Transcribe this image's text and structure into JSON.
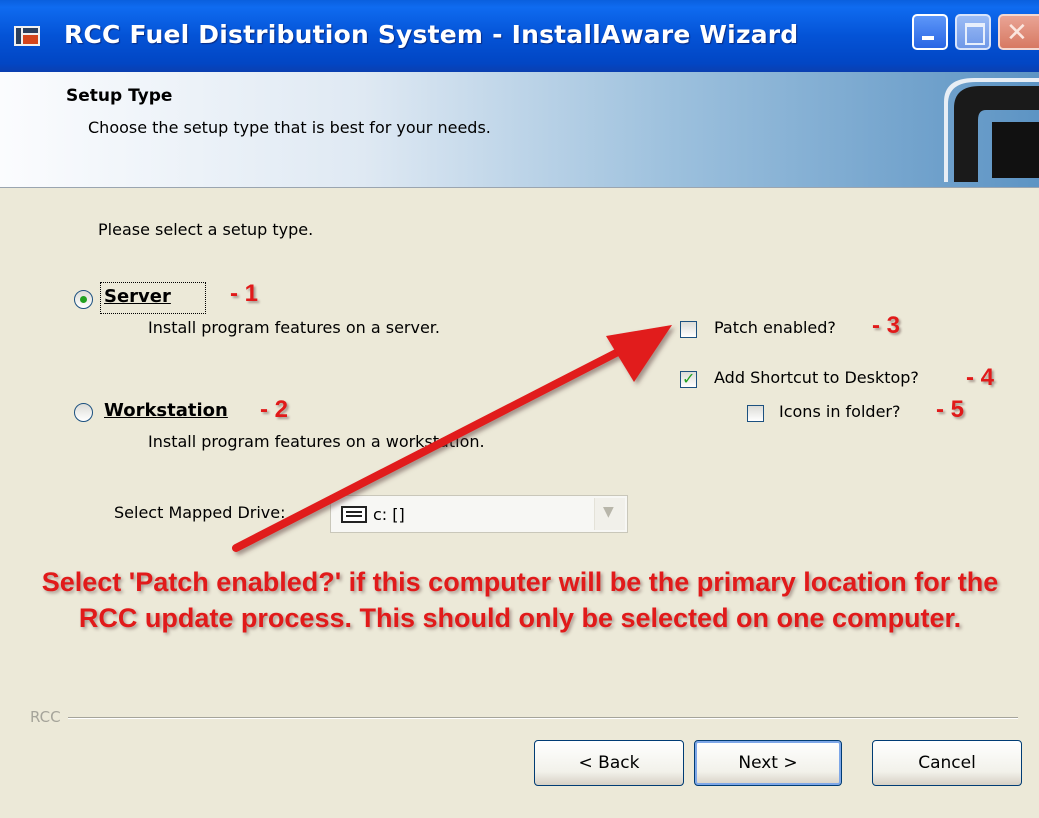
{
  "window": {
    "title": "RCC Fuel Distribution System - InstallAware Wizard",
    "controls": [
      "minimize",
      "maximize",
      "close"
    ]
  },
  "header": {
    "title": "Setup Type",
    "subtitle": "Choose the setup type that is best for your needs."
  },
  "prompt": "Please select a setup type.",
  "setup_types": [
    {
      "label": "Server",
      "description": "Install program features on a server.",
      "selected": true,
      "annotation": "- 1"
    },
    {
      "label": "Workstation",
      "description": "Install program features on a workstation.",
      "selected": false,
      "annotation": "- 2"
    }
  ],
  "options": [
    {
      "label": "Patch enabled?",
      "checked": false,
      "annotation": "- 3"
    },
    {
      "label": "Add Shortcut to Desktop?",
      "checked": true,
      "annotation": "- 4"
    },
    {
      "label": "Icons in folder?",
      "checked": false,
      "annotation": "- 5"
    }
  ],
  "mapped_drive": {
    "label": "Select Mapped Drive:",
    "value": "c: []"
  },
  "note": "Select 'Patch enabled?' if this computer will be the primary location for the RCC update process.  This should only be selected on one computer.",
  "footer": {
    "group_label": "RCC",
    "back_label": "< Back",
    "next_label": "Next >",
    "cancel_label": "Cancel"
  },
  "colors": {
    "annotation": "#e11a1a",
    "titlebar": "#0453d6",
    "dialog_bg": "#ece9d8",
    "check_mark": "#21a121"
  }
}
